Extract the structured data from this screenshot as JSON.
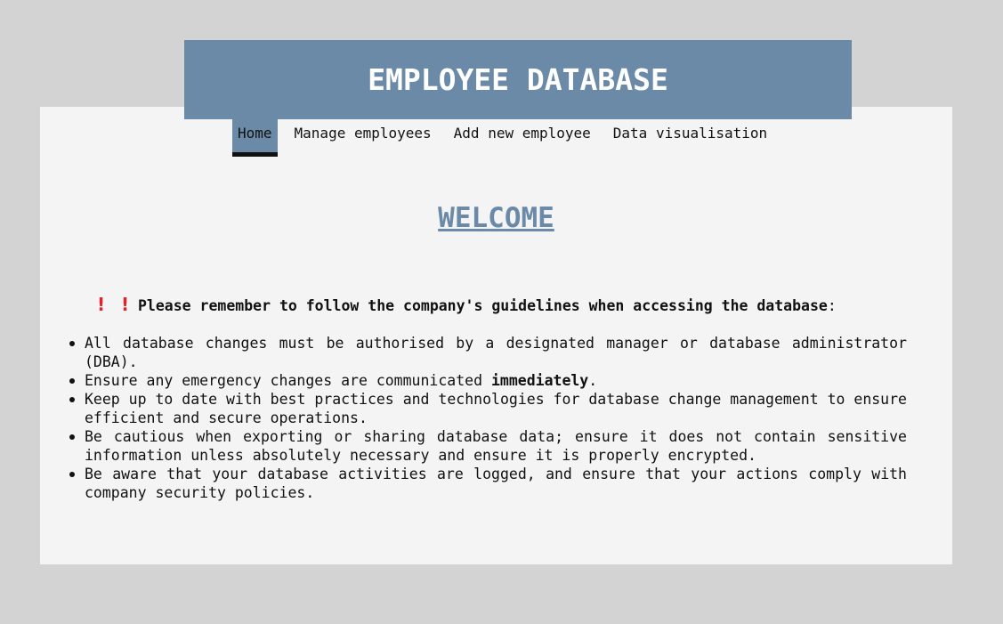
{
  "header": {
    "title": "EMPLOYEE DATABASE"
  },
  "nav": {
    "items": [
      {
        "label": "Home",
        "active": true
      },
      {
        "label": "Manage employees",
        "active": false
      },
      {
        "label": "Add new employee",
        "active": false
      },
      {
        "label": "Data visualisation",
        "active": false
      }
    ]
  },
  "main": {
    "heading": "WELCOME",
    "notice": {
      "icons": [
        "exclamation-icon",
        "exclamation-icon"
      ],
      "bold_text": "Please remember to follow the company's guidelines when accessing the database",
      "suffix": ":"
    },
    "rules": [
      {
        "text": "All database changes must be authorised by a designated manager or database administrator (DBA)."
      },
      {
        "prefix": "Ensure any emergency changes are communicated ",
        "bold": "immediately",
        "suffix": "."
      },
      {
        "text": "Keep up to date with best practices and technologies for database change management to ensure efficient and secure operations."
      },
      {
        "text": "Be cautious when exporting or sharing database data; ensure it does not contain sensitive information unless absolutely necessary and ensure it is properly encrypted."
      },
      {
        "text": "Be aware that your database activities are logged, and ensure that your actions comply with company security policies."
      }
    ]
  },
  "colors": {
    "background": "#d3d3d3",
    "panel": "#f4f4f4",
    "accent": "#6a8aa8",
    "alert": "#e0242b",
    "text": "#111111"
  }
}
